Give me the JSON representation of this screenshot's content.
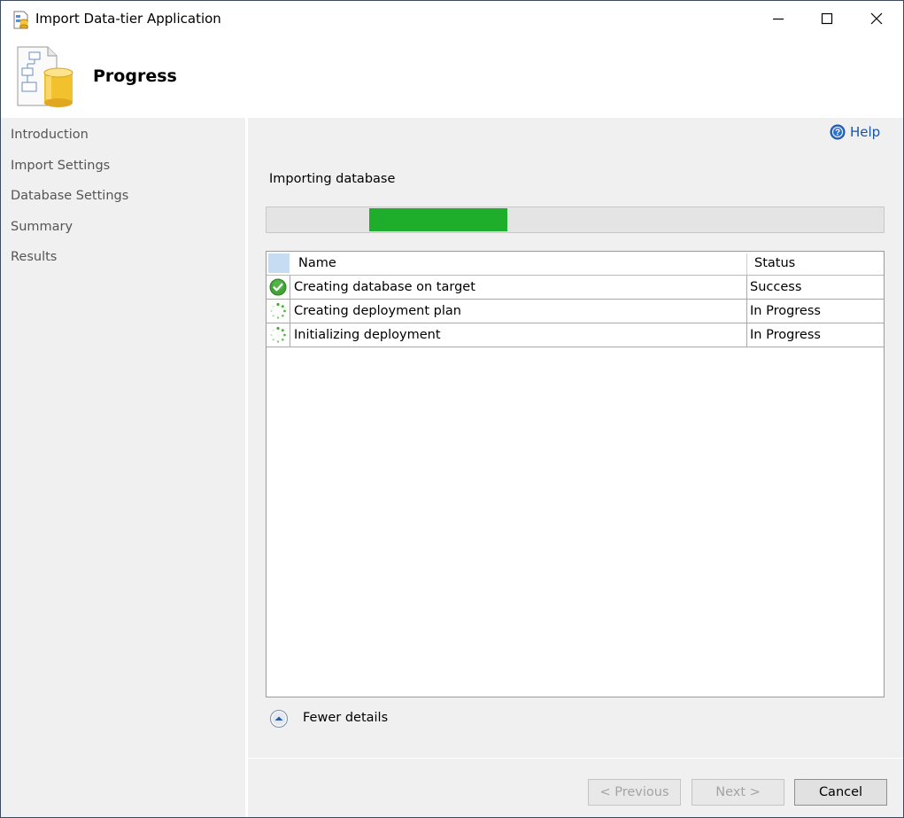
{
  "window": {
    "title": "Import Data-tier Application"
  },
  "header": {
    "title": "Progress",
    "icon": "database-import-icon"
  },
  "sidebar": {
    "items": [
      {
        "label": "Introduction"
      },
      {
        "label": "Import Settings"
      },
      {
        "label": "Database Settings"
      },
      {
        "label": "Summary"
      },
      {
        "label": "Results"
      }
    ]
  },
  "main": {
    "help_label": "Help",
    "status_text": "Importing database",
    "progress": {
      "value": 0.39,
      "fill_color": "#1fae2b"
    },
    "table": {
      "columns": [
        "Name",
        "Status"
      ],
      "rows": [
        {
          "name": "Creating database on target",
          "status": "Success",
          "icon": "success-check-icon"
        },
        {
          "name": "Creating deployment plan",
          "status": "In Progress",
          "icon": "in-progress-spinner-icon"
        },
        {
          "name": "Initializing deployment",
          "status": "In Progress",
          "icon": "in-progress-spinner-icon"
        }
      ]
    },
    "details_toggle": "Fewer details"
  },
  "footer": {
    "previous_label": "< Previous",
    "next_label": "Next >",
    "cancel_label": "Cancel"
  }
}
